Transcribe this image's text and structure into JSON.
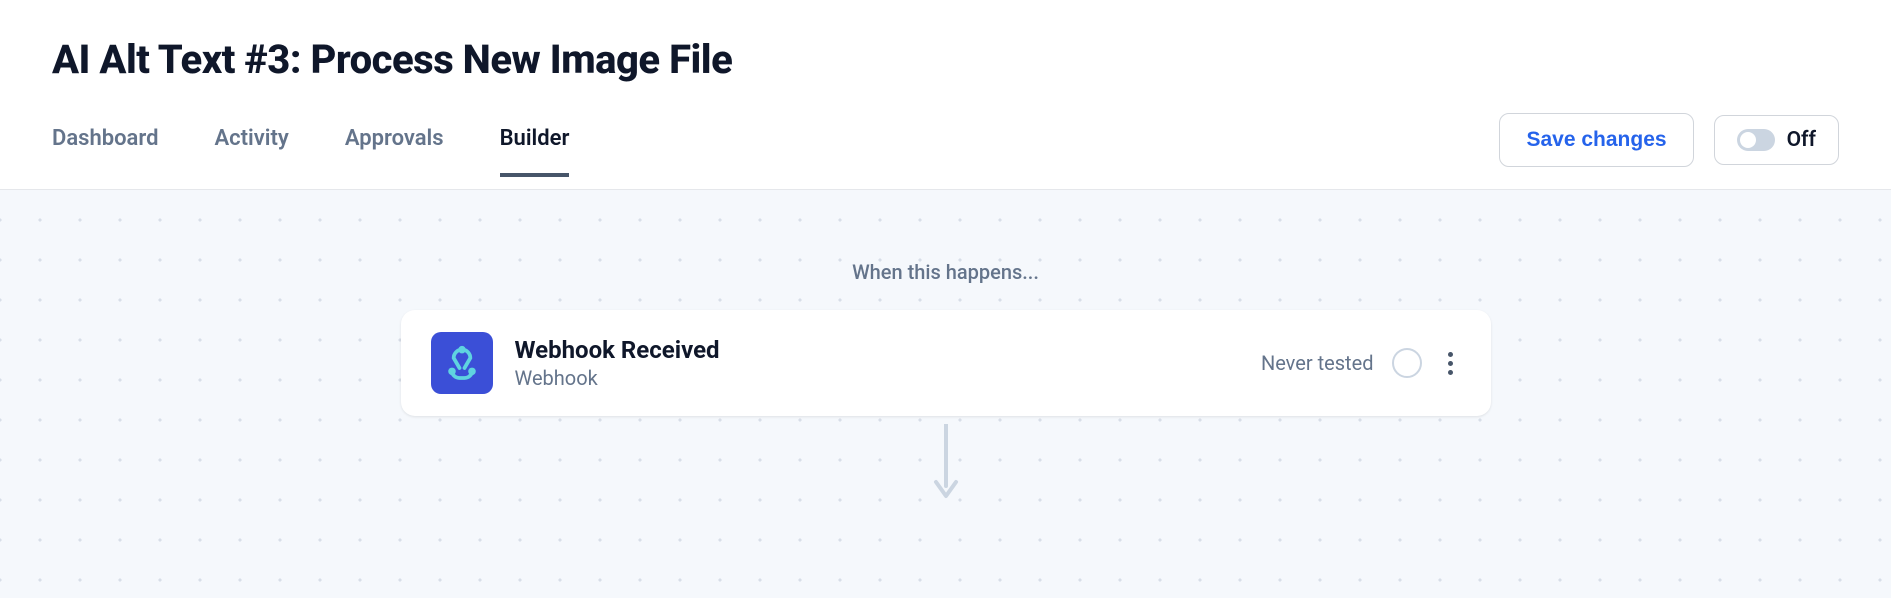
{
  "header": {
    "title": "AI Alt Text #3: Process New Image File",
    "save_label": "Save changes",
    "toggle_label": "Off"
  },
  "tabs": [
    {
      "label": "Dashboard",
      "active": false
    },
    {
      "label": "Activity",
      "active": false
    },
    {
      "label": "Approvals",
      "active": false
    },
    {
      "label": "Builder",
      "active": true
    }
  ],
  "canvas": {
    "section_label": "When this happens...",
    "node": {
      "title": "Webhook Received",
      "subtitle": "Webhook",
      "status": "Never tested",
      "icon": "webhook-icon"
    }
  }
}
